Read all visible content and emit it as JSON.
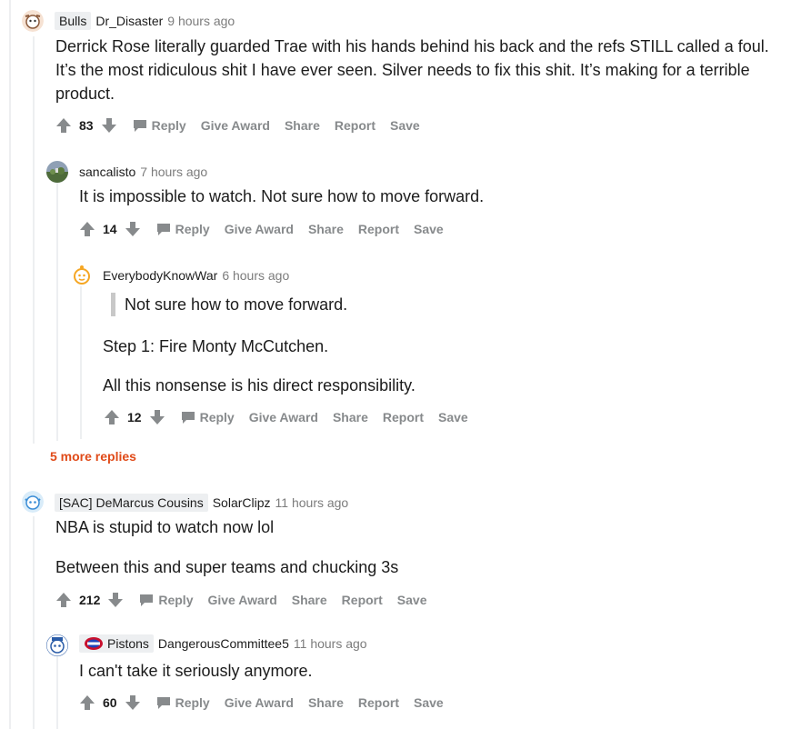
{
  "comments": [
    {
      "flair": "Bulls",
      "user": "Dr_Disaster",
      "time": "9 hours ago",
      "body": [
        "Derrick Rose literally guarded Trae with his hands behind his back and the refs STILL called a foul. It’s the most ridiculous shit I have ever seen. Silver needs to fix this shit. It’s making for a terrible product."
      ],
      "votes": "83"
    },
    {
      "user": "sancalisto",
      "time": "7 hours ago",
      "body": [
        "It is impossible to watch. Not sure how to move forward."
      ],
      "votes": "14"
    },
    {
      "user": "EverybodyKnowWar",
      "time": "6 hours ago",
      "quote": "Not sure how to move forward.",
      "body": [
        "Step 1: Fire Monty McCutchen.",
        "All this nonsense is his direct responsibility."
      ],
      "votes": "12"
    },
    {
      "flair": "[SAC] DeMarcus Cousins",
      "user": "SolarClipz",
      "time": "11 hours ago",
      "body": [
        "NBA is stupid to watch now lol",
        "Between this and super teams and chucking 3s"
      ],
      "votes": "212"
    },
    {
      "flair": "Pistons",
      "user": "DangerousCommittee5",
      "time": "11 hours ago",
      "body": [
        "I can't take it seriously anymore."
      ],
      "votes": "60"
    }
  ],
  "actions": {
    "reply": "Reply",
    "give_award": "Give Award",
    "share": "Share",
    "report": "Report",
    "save": "Save"
  },
  "more_replies": "5 more replies",
  "colors": {
    "upvote": "#878a8c",
    "more": "#e04a18",
    "flair_bg": "#edeff1"
  }
}
